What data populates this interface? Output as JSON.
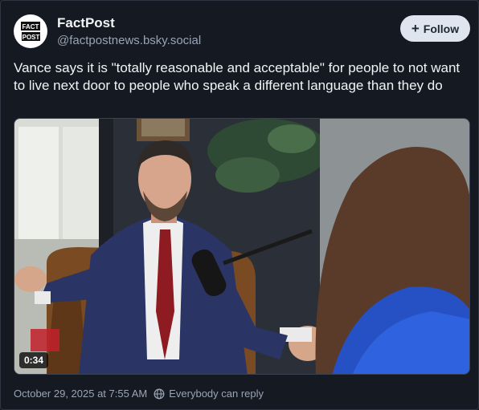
{
  "post": {
    "author": {
      "display_name": "FactPost",
      "handle": "@factpostnews.bsky.social",
      "avatar_text_line1": "FACT",
      "avatar_text_line2": "POST"
    },
    "follow_label": "Follow",
    "text": "Vance says it is \"totally reasonable and acceptable\" for people to not want to live next door to people who speak a different language than they do",
    "video": {
      "duration": "0:34"
    },
    "timestamp": "October 29, 2025 at 7:55 AM",
    "reply_setting": "Everybody can reply"
  },
  "colors": {
    "background": "#151a22",
    "secondary_text": "#9aa4b4",
    "follow_button_bg": "#dfe5ee"
  },
  "icons": {
    "follow": "plus-icon",
    "reply_setting": "globe-icon"
  }
}
